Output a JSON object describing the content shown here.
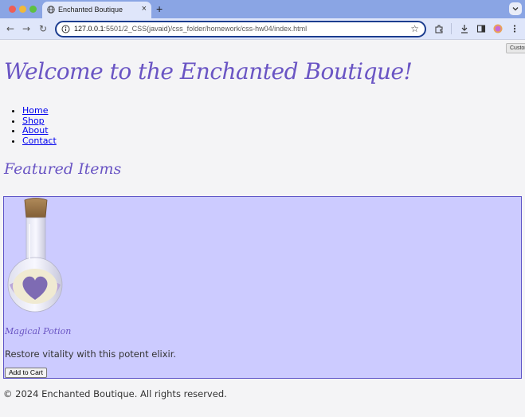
{
  "browser": {
    "tab_title": "Enchanted Boutique",
    "tab_close": "×",
    "new_tab": "+",
    "url_host": "127.0.0.1",
    "url_path": ":5501/2_CSS(javaid)/css_folder/homework/css-hw04/index.html",
    "tooltip": "Customize Chrome",
    "icons": [
      "globe-icon",
      "back-icon",
      "forward-icon",
      "reload-icon",
      "info-icon",
      "star-icon",
      "extensions-icon",
      "download-icon",
      "sidepanel-icon",
      "profile-icon",
      "menu-icon"
    ]
  },
  "header": {
    "title": "Welcome to the Enchanted Boutique!"
  },
  "nav": {
    "items": [
      {
        "label": "Home"
      },
      {
        "label": "Shop"
      },
      {
        "label": "About"
      },
      {
        "label": "Contact"
      }
    ]
  },
  "featured": {
    "heading": "Featured Items",
    "product": {
      "name": "Magical Potion",
      "description": "Restore vitality with this potent elixir.",
      "button_label": "Add to Cart",
      "image_icon": "potion-bottle-icon"
    }
  },
  "footer": {
    "text": "© 2024 Enchanted Boutique. All rights reserved."
  },
  "colors": {
    "accent": "#6a55c4",
    "card_bg": "#cccbff",
    "card_border": "#5e55c8",
    "link": "#0000ee"
  }
}
